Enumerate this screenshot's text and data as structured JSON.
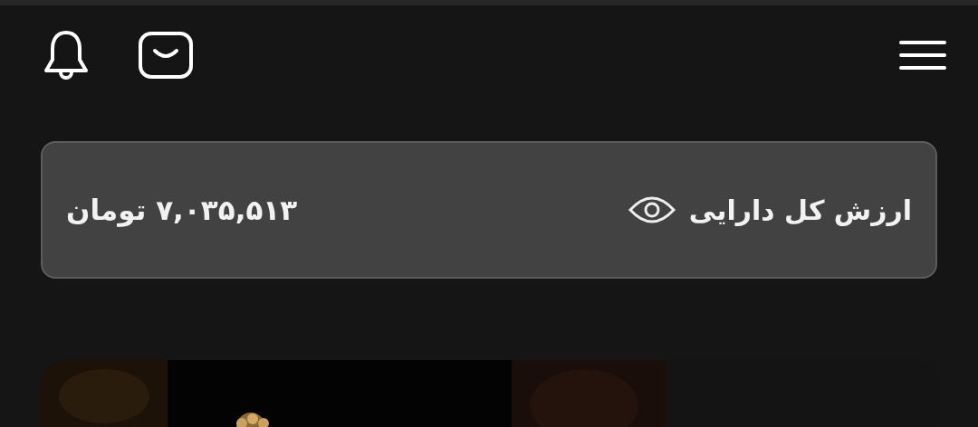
{
  "balance": {
    "label": "ارزش کل دارایی",
    "amount": "۷,۰۳۵,۵۱۳ تومان"
  }
}
